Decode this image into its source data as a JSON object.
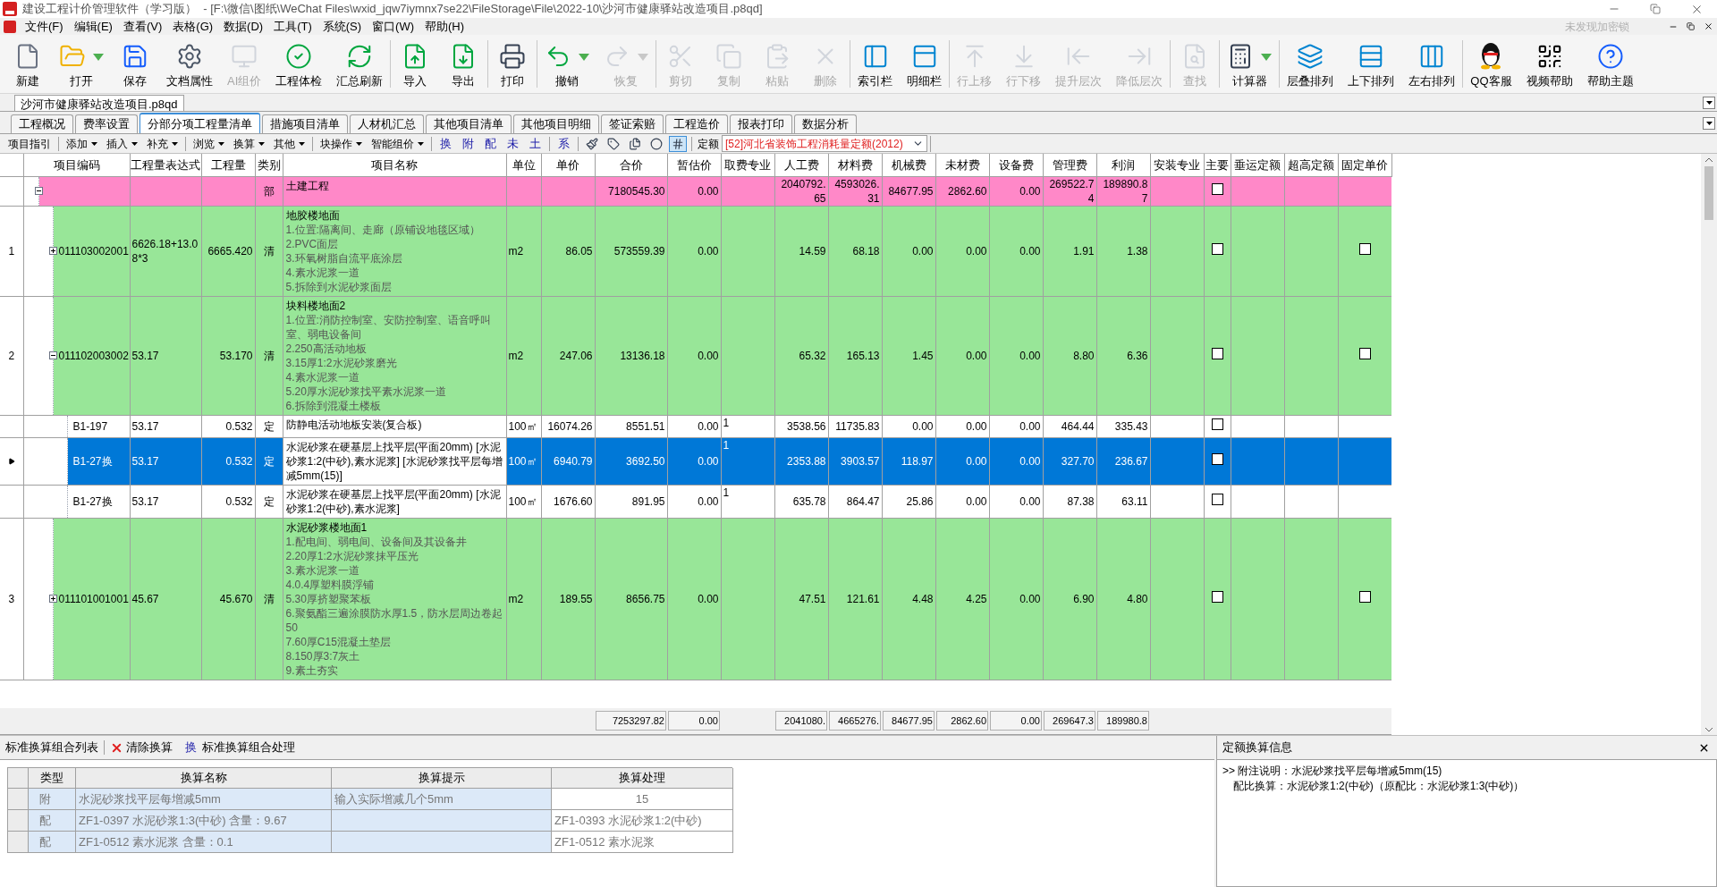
{
  "window": {
    "title": "建设工程计价管理软件（学习版）  - [F:\\微信\\图纸\\WeChat Files\\wxid_jqw7iymnx7se22\\FileStorage\\File\\2022-10\\沙河市健康驿站改造项目.p8qd]"
  },
  "menu": [
    "文件(F)",
    "编辑(E)",
    "查看(V)",
    "表格(G)",
    "数据(D)",
    "工具(T)",
    "系统(S)",
    "窗口(W)",
    "帮助(H)"
  ],
  "lock_status": "未发现加密锁",
  "toolbar": [
    [
      {
        "label": "新建",
        "disabled": false,
        "dropdown": false
      },
      {
        "label": "打开",
        "disabled": false,
        "dropdown": true
      },
      {
        "label": "保存",
        "disabled": false,
        "dropdown": false
      },
      {
        "label": "文档属性",
        "disabled": false,
        "dropdown": false
      },
      {
        "label": "AI组价",
        "disabled": true,
        "dropdown": false
      },
      {
        "label": "工程体检",
        "disabled": false,
        "dropdown": false
      },
      {
        "label": "汇总刷新",
        "disabled": false,
        "dropdown": false
      }
    ],
    [
      {
        "label": "导入",
        "disabled": false,
        "dropdown": false
      },
      {
        "label": "导出",
        "disabled": false,
        "dropdown": false
      }
    ],
    [
      {
        "label": "打印",
        "disabled": false,
        "dropdown": false
      }
    ],
    [
      {
        "label": "撤销",
        "disabled": false,
        "dropdown": true
      },
      {
        "label": "恢复",
        "disabled": true,
        "dropdown": true
      }
    ],
    [
      {
        "label": "剪切",
        "disabled": true,
        "dropdown": false
      },
      {
        "label": "复制",
        "disabled": true,
        "dropdown": false
      },
      {
        "label": "粘贴",
        "disabled": true,
        "dropdown": false
      },
      {
        "label": "删除",
        "disabled": true,
        "dropdown": false
      }
    ],
    [
      {
        "label": "索引栏",
        "disabled": false,
        "dropdown": false
      },
      {
        "label": "明细栏",
        "disabled": false,
        "dropdown": false
      }
    ],
    [
      {
        "label": "行上移",
        "disabled": true,
        "dropdown": false
      },
      {
        "label": "行下移",
        "disabled": true,
        "dropdown": false
      },
      {
        "label": "提升层次",
        "disabled": true,
        "dropdown": false
      },
      {
        "label": "降低层次",
        "disabled": true,
        "dropdown": false
      }
    ],
    [
      {
        "label": "查找",
        "disabled": true,
        "dropdown": false
      }
    ],
    [
      {
        "label": "计算器",
        "disabled": false,
        "dropdown": true
      }
    ],
    [
      {
        "label": "层叠排列",
        "disabled": false,
        "dropdown": false
      },
      {
        "label": "上下排列",
        "disabled": false,
        "dropdown": false
      },
      {
        "label": "左右排列",
        "disabled": false,
        "dropdown": false
      }
    ],
    [
      {
        "label": "QQ客服",
        "disabled": false,
        "dropdown": false
      },
      {
        "label": "视频帮助",
        "disabled": false,
        "dropdown": false
      },
      {
        "label": "帮助主题",
        "disabled": false,
        "dropdown": false
      }
    ]
  ],
  "document_tabs": [
    {
      "label": "沙河市健康驿站改造项目.p8qd",
      "selected": true
    }
  ],
  "tabs": [
    {
      "label": "工程概况",
      "selected": false
    },
    {
      "label": "费率设置",
      "selected": false
    },
    {
      "label": "分部分项工程量清单",
      "selected": true
    },
    {
      "label": "措施项目清单",
      "selected": false
    },
    {
      "label": "人材机汇总",
      "selected": false
    },
    {
      "label": "其他项目清单",
      "selected": false
    },
    {
      "label": "其他项目明细",
      "selected": false
    },
    {
      "label": "签证索赔",
      "selected": false
    },
    {
      "label": "工程造价",
      "selected": false
    },
    {
      "label": "报表打印",
      "selected": false
    },
    {
      "label": "数据分析",
      "selected": false
    }
  ],
  "sub_toolbar": {
    "menus": [
      [
        {
          "label": "项目指引",
          "dropdown": false
        }
      ],
      [
        {
          "label": "添加",
          "dropdown": true
        },
        {
          "label": "插入",
          "dropdown": true
        },
        {
          "label": "补充",
          "dropdown": true
        }
      ],
      [
        {
          "label": "浏览",
          "dropdown": true
        },
        {
          "label": "换算",
          "dropdown": true
        },
        {
          "label": "其他",
          "dropdown": true
        }
      ],
      [
        {
          "label": "块操作",
          "dropdown": true
        },
        {
          "label": "智能组价",
          "dropdown": true
        }
      ]
    ],
    "quick": [
      [
        "换",
        "附",
        "配",
        "未",
        "土"
      ],
      [
        "系"
      ]
    ],
    "icon_buttons": [
      {
        "pressed": false
      },
      {
        "pressed": false
      },
      {
        "pressed": false
      },
      {
        "pressed": false
      },
      {
        "pressed": true
      }
    ],
    "quota_label": "定额",
    "quota_select": "[52]河北省装饰工程消耗量定额(2012)"
  },
  "table": {
    "columns": [
      "项目编码",
      "工程量表达式",
      "工程量",
      "类别",
      "项目名称",
      "单位",
      "单价",
      "合价",
      "暂估价",
      "取费专业",
      "人工费",
      "材料费",
      "机械费",
      "未材费",
      "设备费",
      "管理费",
      "利润",
      "安装专业",
      "主要",
      "垂运定额",
      "超高定额",
      "固定单价"
    ],
    "rows": [
      {
        "kind": "division",
        "expanded": true,
        "selected": false,
        "category": "部",
        "name": "土建工程",
        "total": "7180545.30",
        "estimate": "0.00",
        "labor": "2040792.65",
        "material": "4593026.31",
        "machine": "84677.95",
        "unpriced": "2862.60",
        "equipment": "0.00",
        "management": "269522.74",
        "profit": "189890.87",
        "main": false,
        "children": [
          {
            "kind": "item",
            "row_number": "1",
            "expanded": false,
            "selected": false,
            "code": "011103002001",
            "expression": "6626.18+13.08*3",
            "quantity": "6665.420",
            "category": "清",
            "name": "地胶楼地面",
            "details": [
              "1.位置:隔离间、走廊（原铺设地毯区域）",
              "2.PVC面层",
              "3.环氧树脂自流平底涂层",
              "4.素水泥浆一道",
              "5.拆除到水泥砂浆面层"
            ],
            "unit": "m2",
            "unit_price": "86.05",
            "total": "573559.39",
            "estimate": "0.00",
            "labor": "14.59",
            "material": "68.18",
            "machine": "0.00",
            "unpriced": "0.00",
            "equipment": "0.00",
            "management": "1.91",
            "profit": "1.38",
            "main": false,
            "fixed_price": false
          },
          {
            "kind": "item",
            "row_number": "2",
            "expanded": true,
            "selected": false,
            "code": "011102003002",
            "expression": "53.17",
            "quantity": "53.170",
            "category": "清",
            "name": "块料楼地面2",
            "details": [
              "1.位置:消防控制室、安防控制室、语音呼叫室、弱电设备间",
              "2.250高活动地板",
              "3.15厚1:2水泥砂浆磨光",
              "4.素水泥浆一道",
              "5.20厚水泥砂浆找平素水泥浆一道",
              "6.拆除到混凝土楼板"
            ],
            "unit": "m2",
            "unit_price": "247.06",
            "total": "13136.18",
            "estimate": "0.00",
            "labor": "65.32",
            "material": "165.13",
            "machine": "1.45",
            "unpriced": "0.00",
            "equipment": "0.00",
            "management": "8.80",
            "profit": "6.36",
            "main": false,
            "fixed_price": false,
            "children": [
              {
                "kind": "quota",
                "selected": false,
                "code": "B1-197",
                "expression": "53.17",
                "quantity": "0.532",
                "category": "定",
                "name": "防静电活动地板安装(复合板)",
                "unit": "100㎡",
                "unit_price": "16074.26",
                "total": "8551.51",
                "estimate": "0.00",
                "fee_type": "1",
                "labor": "3538.56",
                "material": "11735.83",
                "machine": "0.00",
                "unpriced": "0.00",
                "equipment": "0.00",
                "management": "464.44",
                "profit": "335.43",
                "main": false
              },
              {
                "kind": "quota",
                "selected": true,
                "code": "B1-27换",
                "expression": "53.17",
                "quantity": "0.532",
                "category": "定",
                "name": "水泥砂浆在硬基层上找平层(平面20mm) [水泥砂浆1:2(中砂),素水泥浆] [水泥砂浆找平层每增减5mm(15)]",
                "unit": "100㎡",
                "unit_price": "6940.79",
                "total": "3692.50",
                "estimate": "0.00",
                "fee_type": "1",
                "labor": "2353.88",
                "material": "3903.57",
                "machine": "118.97",
                "unpriced": "0.00",
                "equipment": "0.00",
                "management": "327.70",
                "profit": "236.67",
                "main": false
              },
              {
                "kind": "quota",
                "selected": false,
                "code": "B1-27换",
                "expression": "53.17",
                "quantity": "0.532",
                "category": "定",
                "name": "水泥砂浆在硬基层上找平层(平面20mm) [水泥砂浆1:2(中砂),素水泥浆]",
                "unit": "100㎡",
                "unit_price": "1676.60",
                "total": "891.95",
                "estimate": "0.00",
                "fee_type": "1",
                "labor": "635.78",
                "material": "864.47",
                "machine": "25.86",
                "unpriced": "0.00",
                "equipment": "0.00",
                "management": "87.38",
                "profit": "63.11",
                "main": false
              }
            ]
          },
          {
            "kind": "item",
            "row_number": "3",
            "expanded": false,
            "selected": false,
            "code": "011101001001",
            "expression": "45.67",
            "quantity": "45.670",
            "category": "清",
            "name": "水泥砂浆楼地面1",
            "details": [
              "1.配电间、弱电间、设备间及其设备井",
              "2.20厚1:2水泥砂浆抹平压光",
              "3.素水泥浆一道",
              "4.0.4厚塑料膜浮铺",
              "5.30厚挤塑聚苯板",
              "6.聚氨酯三遍涂膜防水厚1.5，防水层周边卷起50",
              "7.60厚C15混凝土垫层",
              "8.150厚3:7灰土",
              "9.素土夯实"
            ],
            "unit": "m2",
            "unit_price": "189.55",
            "total": "8656.75",
            "estimate": "0.00",
            "labor": "47.51",
            "material": "121.61",
            "machine": "4.48",
            "unpriced": "4.25",
            "equipment": "0.00",
            "management": "6.90",
            "profit": "4.80",
            "main": false,
            "fixed_price": false
          }
        ]
      }
    ],
    "totals": {
      "total": "7253297.82",
      "estimate": "0.00",
      "labor": "2041080.",
      "material": "4665276.",
      "machine": "84677.95",
      "unpriced": "2862.60",
      "equipment": "0.00",
      "management": "269647.3",
      "profit": "189980.8"
    }
  },
  "conversion_panel": {
    "title": "标准换算组合列表",
    "clear_button": "清除换算",
    "process_icon": "换",
    "process_button": "标准换算组合处理",
    "columns": [
      "类型",
      "换算名称",
      "换算提示",
      "换算处理"
    ],
    "rows": [
      {
        "kind": "input",
        "type": "附",
        "name": "水泥砂浆找平层每增减5mm",
        "hint": "输入实际增减几个5mm",
        "value": "15"
      },
      {
        "kind": "select",
        "type": "配",
        "name": "ZF1-0397 水泥砂浆1:3(中砂) 含量：9.67",
        "value": "ZF1-0393 水泥砂浆1:2(中砂)"
      },
      {
        "kind": "select",
        "type": "配",
        "name": "ZF1-0512 素水泥浆 含量：0.1",
        "value": "ZF1-0512 素水泥浆"
      }
    ]
  },
  "info_panel": {
    "title": "定额换算信息",
    "lines": [
      ">> 附注说明：水泥砂浆找平层每增减5mm(15)",
      "配比换算：水泥砂浆1:2(中砂)（原配比：水泥砂浆1:3(中砂)）"
    ]
  }
}
